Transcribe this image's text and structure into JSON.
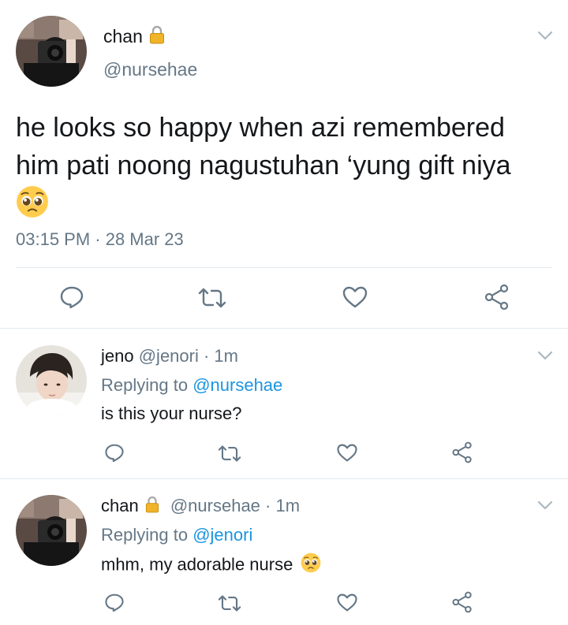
{
  "main_tweet": {
    "display_name": "chan",
    "handle": "@nursehae",
    "text": "he looks so happy when azi remembered him pati noong nagustuhan ‘yung gift niya",
    "emoji": "pleading-face",
    "timestamp": "03:15 PM · 28 Mar 23"
  },
  "replies": [
    {
      "display_name": "jeno",
      "handle": "@jenori",
      "time": "· 1m",
      "replying_prefix": "Replying to",
      "replying_to": "@nursehae",
      "text": "is this your nurse?",
      "locked": false
    },
    {
      "display_name": "chan",
      "handle": "@nursehae",
      "time": "· 1m",
      "replying_prefix": "Replying to",
      "replying_to": "@jenori",
      "text": "mhm, my adorable nurse",
      "locked": true,
      "emoji": "pleading-face"
    }
  ],
  "icons": {
    "reply": "speech-bubble-icon",
    "retweet": "retweet-icon",
    "like": "heart-icon",
    "share": "share-icon",
    "more": "chevron-down-icon",
    "lock": "lock-icon"
  },
  "colors": {
    "text": "#14171a",
    "muted": "#657786",
    "link": "#1b95e0",
    "icon": "#657786",
    "divider": "#e1e8ed"
  }
}
